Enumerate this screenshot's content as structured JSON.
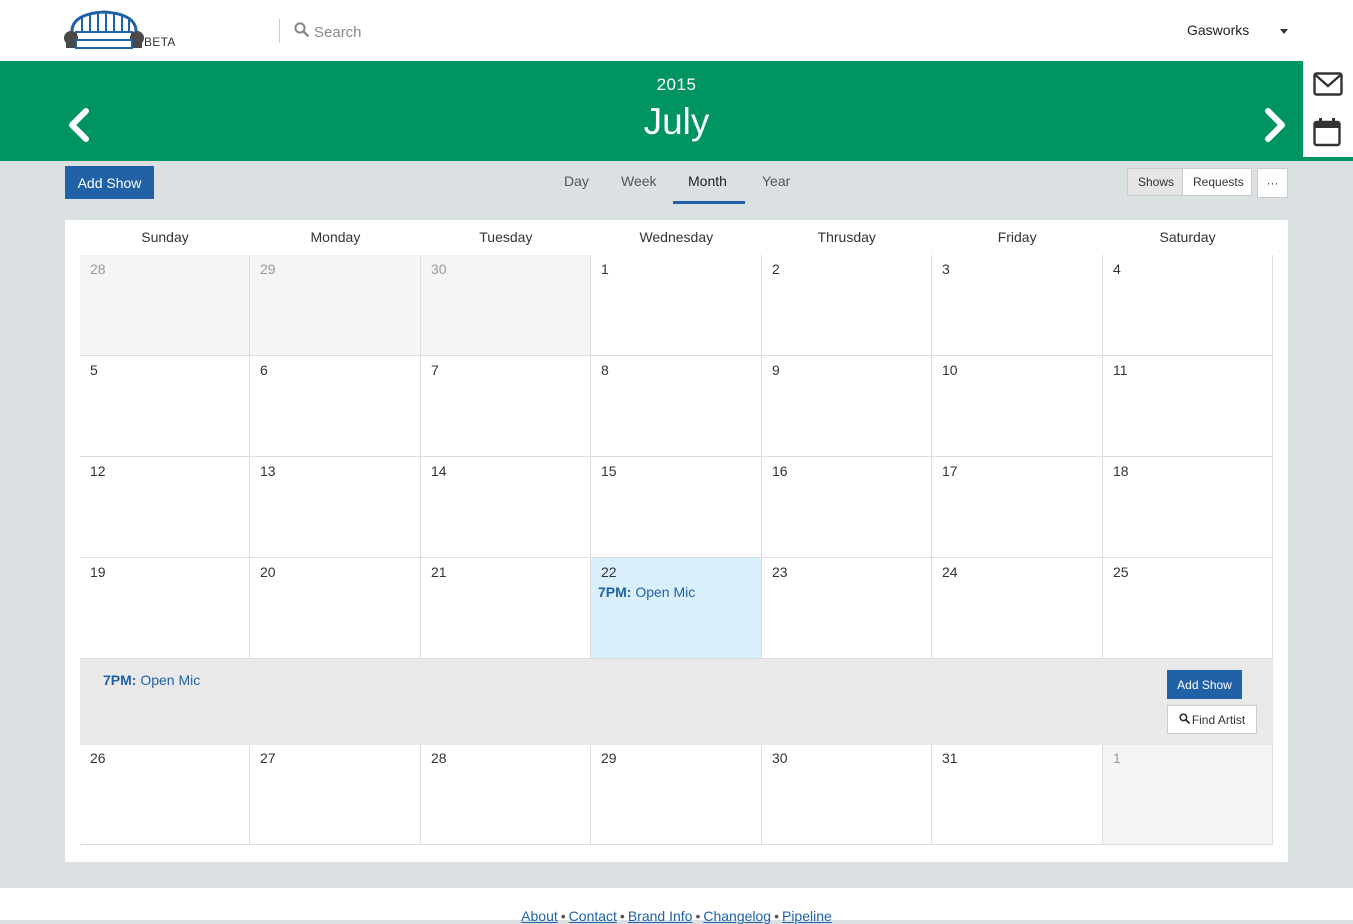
{
  "header": {
    "logo_tag": "BETA",
    "search": {
      "placeholder": "Search"
    },
    "venue": "Gasworks"
  },
  "band": {
    "year": "2015",
    "month": "July"
  },
  "toolbar": {
    "add_show": "Add Show",
    "views": [
      "Day",
      "Week",
      "Month",
      "Year"
    ],
    "active_view": "Month",
    "filter_toggle": [
      "Shows",
      "Requests"
    ],
    "active_filter": "Shows",
    "more": "···"
  },
  "calendar": {
    "weekdays": [
      "Sunday",
      "Monday",
      "Tuesday",
      "Wednesday",
      "Thrusday",
      "Friday",
      "Saturday"
    ],
    "weeks": [
      [
        {
          "d": "28",
          "other": true
        },
        {
          "d": "29",
          "other": true
        },
        {
          "d": "30",
          "other": true
        },
        {
          "d": "1"
        },
        {
          "d": "2"
        },
        {
          "d": "3"
        },
        {
          "d": "4"
        }
      ],
      [
        {
          "d": "5"
        },
        {
          "d": "6"
        },
        {
          "d": "7"
        },
        {
          "d": "8"
        },
        {
          "d": "9"
        },
        {
          "d": "10"
        },
        {
          "d": "11"
        }
      ],
      [
        {
          "d": "12"
        },
        {
          "d": "13"
        },
        {
          "d": "14"
        },
        {
          "d": "15"
        },
        {
          "d": "16"
        },
        {
          "d": "17"
        },
        {
          "d": "18"
        }
      ],
      [
        {
          "d": "19"
        },
        {
          "d": "20"
        },
        {
          "d": "21"
        },
        {
          "d": "22",
          "today": true,
          "event": {
            "time": "7PM:",
            "title": "Open Mic"
          }
        },
        {
          "d": "23"
        },
        {
          "d": "24"
        },
        {
          "d": "25"
        }
      ],
      [
        {
          "d": "26"
        },
        {
          "d": "27"
        },
        {
          "d": "28"
        },
        {
          "d": "29"
        },
        {
          "d": "30"
        },
        {
          "d": "31"
        },
        {
          "d": "1",
          "other": true
        }
      ]
    ],
    "detail": {
      "event_time": "7PM:",
      "event_title": "Open Mic",
      "add_show": "Add Show",
      "find_artist": "Find Artist"
    }
  },
  "footer": {
    "links": [
      "About",
      "Contact",
      "Brand Info",
      "Changelog",
      "Pipeline"
    ],
    "separator": "•"
  },
  "colors": {
    "brand_green": "#009364",
    "primary_blue": "#2162a7",
    "today_bg": "#d9f0fc"
  },
  "icons": [
    "sofa-logo-icon",
    "search-icon",
    "chevron-left-icon",
    "chevron-right-icon",
    "mail-icon",
    "calendar-icon",
    "search-icon"
  ]
}
